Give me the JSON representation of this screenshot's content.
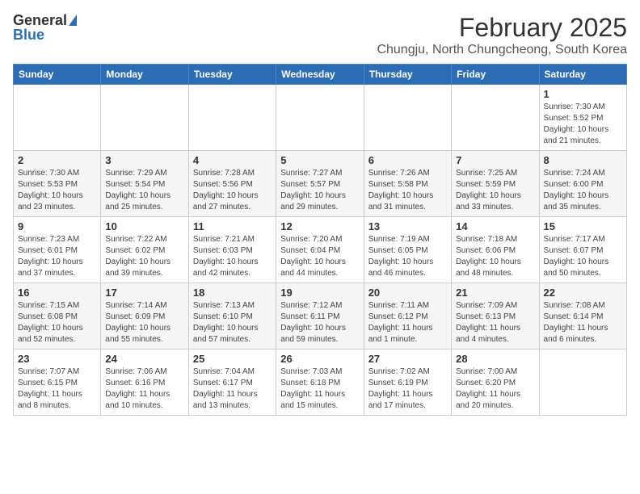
{
  "logo": {
    "general": "General",
    "blue": "Blue"
  },
  "title": "February 2025",
  "subtitle": "Chungju, North Chungcheong, South Korea",
  "days_of_week": [
    "Sunday",
    "Monday",
    "Tuesday",
    "Wednesday",
    "Thursday",
    "Friday",
    "Saturday"
  ],
  "weeks": [
    [
      {
        "day": "",
        "info": ""
      },
      {
        "day": "",
        "info": ""
      },
      {
        "day": "",
        "info": ""
      },
      {
        "day": "",
        "info": ""
      },
      {
        "day": "",
        "info": ""
      },
      {
        "day": "",
        "info": ""
      },
      {
        "day": "1",
        "info": "Sunrise: 7:30 AM\nSunset: 5:52 PM\nDaylight: 10 hours and 21 minutes."
      }
    ],
    [
      {
        "day": "2",
        "info": "Sunrise: 7:30 AM\nSunset: 5:53 PM\nDaylight: 10 hours and 23 minutes."
      },
      {
        "day": "3",
        "info": "Sunrise: 7:29 AM\nSunset: 5:54 PM\nDaylight: 10 hours and 25 minutes."
      },
      {
        "day": "4",
        "info": "Sunrise: 7:28 AM\nSunset: 5:56 PM\nDaylight: 10 hours and 27 minutes."
      },
      {
        "day": "5",
        "info": "Sunrise: 7:27 AM\nSunset: 5:57 PM\nDaylight: 10 hours and 29 minutes."
      },
      {
        "day": "6",
        "info": "Sunrise: 7:26 AM\nSunset: 5:58 PM\nDaylight: 10 hours and 31 minutes."
      },
      {
        "day": "7",
        "info": "Sunrise: 7:25 AM\nSunset: 5:59 PM\nDaylight: 10 hours and 33 minutes."
      },
      {
        "day": "8",
        "info": "Sunrise: 7:24 AM\nSunset: 6:00 PM\nDaylight: 10 hours and 35 minutes."
      }
    ],
    [
      {
        "day": "9",
        "info": "Sunrise: 7:23 AM\nSunset: 6:01 PM\nDaylight: 10 hours and 37 minutes."
      },
      {
        "day": "10",
        "info": "Sunrise: 7:22 AM\nSunset: 6:02 PM\nDaylight: 10 hours and 39 minutes."
      },
      {
        "day": "11",
        "info": "Sunrise: 7:21 AM\nSunset: 6:03 PM\nDaylight: 10 hours and 42 minutes."
      },
      {
        "day": "12",
        "info": "Sunrise: 7:20 AM\nSunset: 6:04 PM\nDaylight: 10 hours and 44 minutes."
      },
      {
        "day": "13",
        "info": "Sunrise: 7:19 AM\nSunset: 6:05 PM\nDaylight: 10 hours and 46 minutes."
      },
      {
        "day": "14",
        "info": "Sunrise: 7:18 AM\nSunset: 6:06 PM\nDaylight: 10 hours and 48 minutes."
      },
      {
        "day": "15",
        "info": "Sunrise: 7:17 AM\nSunset: 6:07 PM\nDaylight: 10 hours and 50 minutes."
      }
    ],
    [
      {
        "day": "16",
        "info": "Sunrise: 7:15 AM\nSunset: 6:08 PM\nDaylight: 10 hours and 52 minutes."
      },
      {
        "day": "17",
        "info": "Sunrise: 7:14 AM\nSunset: 6:09 PM\nDaylight: 10 hours and 55 minutes."
      },
      {
        "day": "18",
        "info": "Sunrise: 7:13 AM\nSunset: 6:10 PM\nDaylight: 10 hours and 57 minutes."
      },
      {
        "day": "19",
        "info": "Sunrise: 7:12 AM\nSunset: 6:11 PM\nDaylight: 10 hours and 59 minutes."
      },
      {
        "day": "20",
        "info": "Sunrise: 7:11 AM\nSunset: 6:12 PM\nDaylight: 11 hours and 1 minute."
      },
      {
        "day": "21",
        "info": "Sunrise: 7:09 AM\nSunset: 6:13 PM\nDaylight: 11 hours and 4 minutes."
      },
      {
        "day": "22",
        "info": "Sunrise: 7:08 AM\nSunset: 6:14 PM\nDaylight: 11 hours and 6 minutes."
      }
    ],
    [
      {
        "day": "23",
        "info": "Sunrise: 7:07 AM\nSunset: 6:15 PM\nDaylight: 11 hours and 8 minutes."
      },
      {
        "day": "24",
        "info": "Sunrise: 7:06 AM\nSunset: 6:16 PM\nDaylight: 11 hours and 10 minutes."
      },
      {
        "day": "25",
        "info": "Sunrise: 7:04 AM\nSunset: 6:17 PM\nDaylight: 11 hours and 13 minutes."
      },
      {
        "day": "26",
        "info": "Sunrise: 7:03 AM\nSunset: 6:18 PM\nDaylight: 11 hours and 15 minutes."
      },
      {
        "day": "27",
        "info": "Sunrise: 7:02 AM\nSunset: 6:19 PM\nDaylight: 11 hours and 17 minutes."
      },
      {
        "day": "28",
        "info": "Sunrise: 7:00 AM\nSunset: 6:20 PM\nDaylight: 11 hours and 20 minutes."
      },
      {
        "day": "",
        "info": ""
      }
    ]
  ]
}
